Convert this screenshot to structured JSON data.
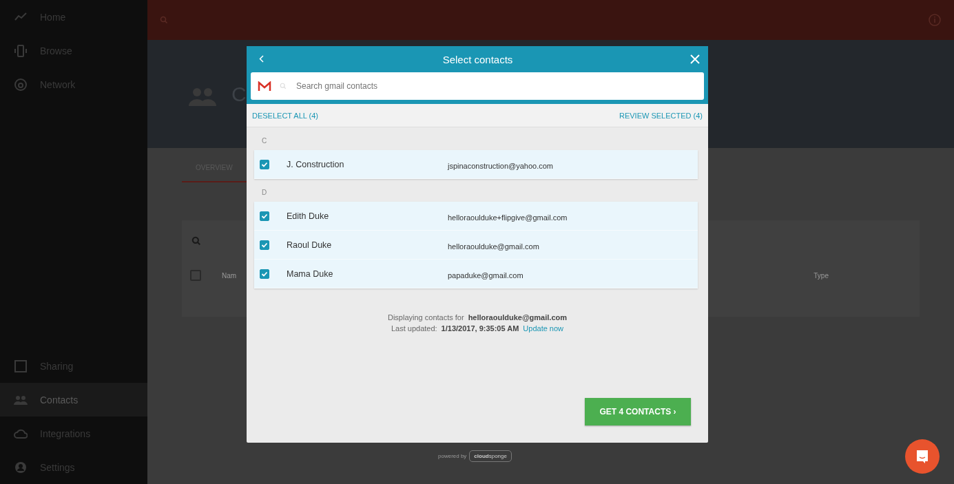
{
  "sidebar": {
    "top_items": [
      {
        "label": "Home",
        "selected": false
      },
      {
        "label": "Browse",
        "selected": false
      },
      {
        "label": "Network",
        "selected": false
      }
    ],
    "bottom_items": [
      {
        "label": "Sharing",
        "selected": false
      },
      {
        "label": "Contacts",
        "selected": true
      },
      {
        "label": "Integrations",
        "selected": false
      },
      {
        "label": "Settings",
        "selected": false
      }
    ]
  },
  "page": {
    "heading": "C",
    "tabs": [
      {
        "label": "OVERVIEW",
        "selected": true
      }
    ],
    "table": {
      "select_all_checked": false,
      "columns": [
        "Nam",
        "Type"
      ]
    }
  },
  "modal": {
    "title": "Select contacts",
    "search": {
      "placeholder": "Search gmail contacts"
    },
    "deselect_all": "DESELECT ALL (4)",
    "review_selected": "REVIEW SELECTED (4)",
    "sections": [
      {
        "letter": "C",
        "contacts": [
          {
            "name": "J. Construction",
            "email": "jspinaconstruction@yahoo.com",
            "checked": true
          }
        ]
      },
      {
        "letter": "D",
        "contacts": [
          {
            "name": "Edith Duke",
            "email": "helloraoulduke+flipgive@gmail.com",
            "checked": true
          },
          {
            "name": "Raoul Duke",
            "email": "helloraoulduke@gmail.com",
            "checked": true
          },
          {
            "name": "Mama Duke",
            "email": "papaduke@gmail.com",
            "checked": true
          }
        ]
      }
    ],
    "displaying_label": "Displaying contacts for",
    "account": "helloraoulduke@gmail.com",
    "updated_label": "Last updated:",
    "updated_time": "1/13/2017, 9:35:05 AM",
    "update_link": "Update now",
    "action_button": "GET 4 CONTACTS ›"
  },
  "powered_by": {
    "label": "powered by",
    "brand": "**cloud**sponge"
  }
}
